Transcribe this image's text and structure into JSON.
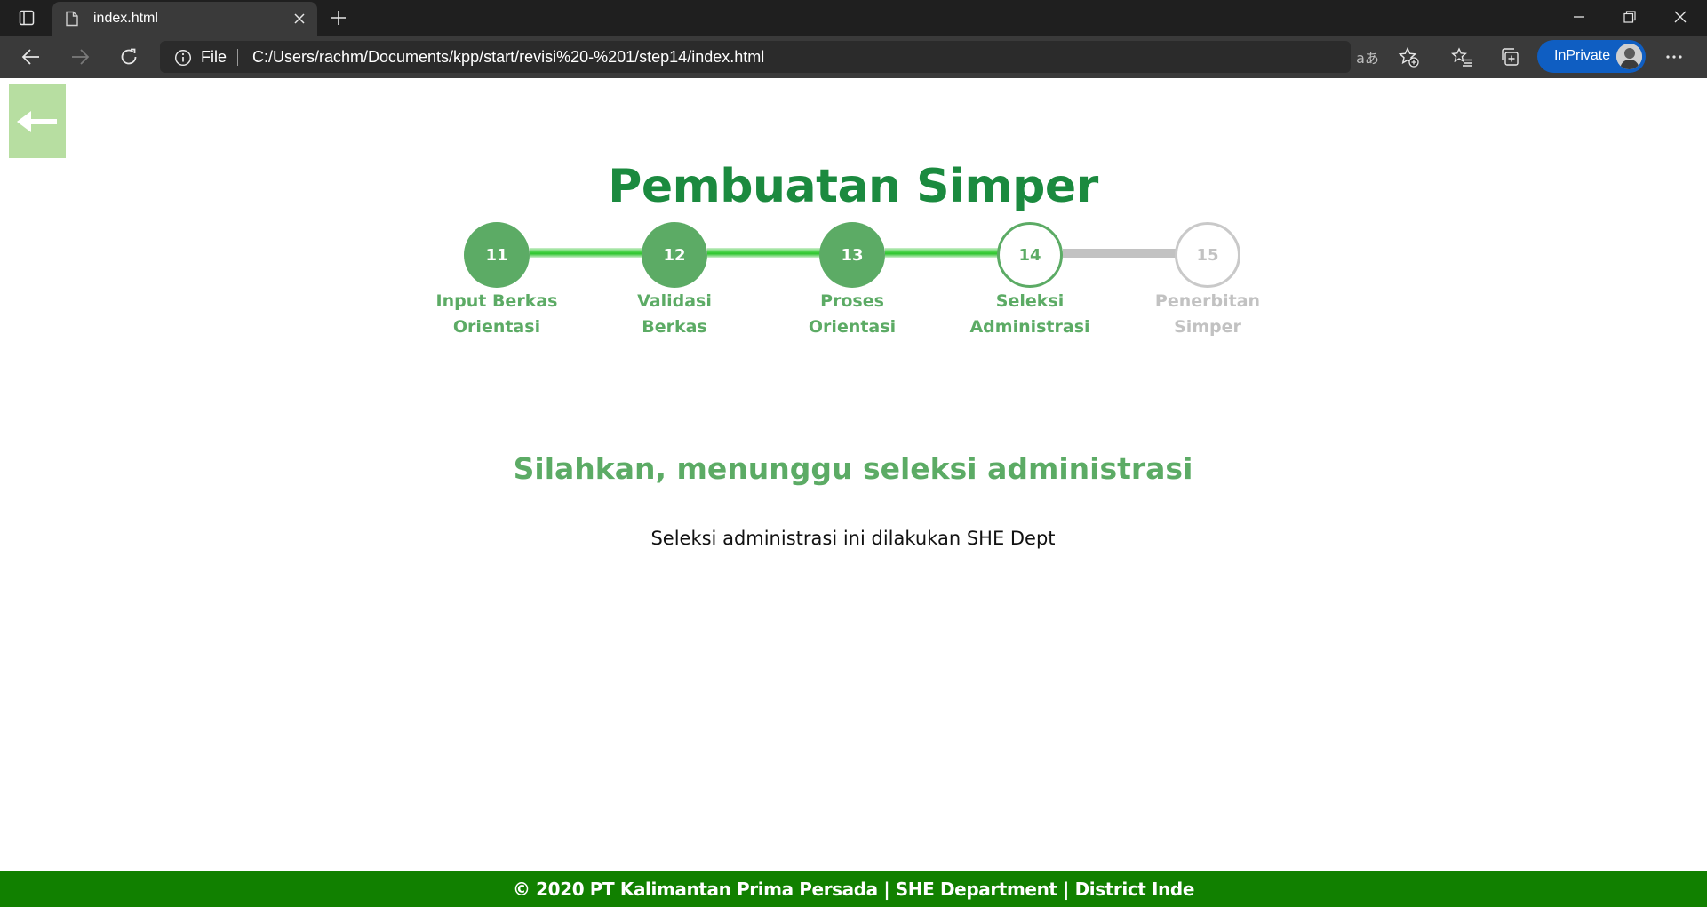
{
  "browser": {
    "tab_title": "index.html",
    "address_prefix": "File",
    "url": "C:/Users/rachm/Documents/kpp/start/revisi%20-%201/step14/index.html",
    "inprivate_label": "InPrivate"
  },
  "page": {
    "title": "Pembuatan Simper",
    "steps": [
      {
        "number": "11",
        "line1": "Input Berkas",
        "line2": "Orientasi",
        "state": "done"
      },
      {
        "number": "12",
        "line1": "Validasi",
        "line2": "Berkas",
        "state": "done"
      },
      {
        "number": "13",
        "line1": "Proses",
        "line2": "Orientasi",
        "state": "done"
      },
      {
        "number": "14",
        "line1": "Seleksi",
        "line2": "Administrasi",
        "state": "active"
      },
      {
        "number": "15",
        "line1": "Penerbitan",
        "line2": "Simper",
        "state": "todo"
      }
    ],
    "subheading": "Silahkan, menunggu seleksi administrasi",
    "info": "Seleksi administrasi ini dilakukan SHE Dept",
    "footer": "© 2020 PT Kalimantan Prima Persada | SHE Department | District Inde"
  },
  "colors": {
    "primary_green": "#1b8a3f",
    "step_green": "#5cab65",
    "inactive_gray": "#c2c2c2",
    "footer_green": "#118000",
    "back_button_bg": "#b7dea1"
  }
}
